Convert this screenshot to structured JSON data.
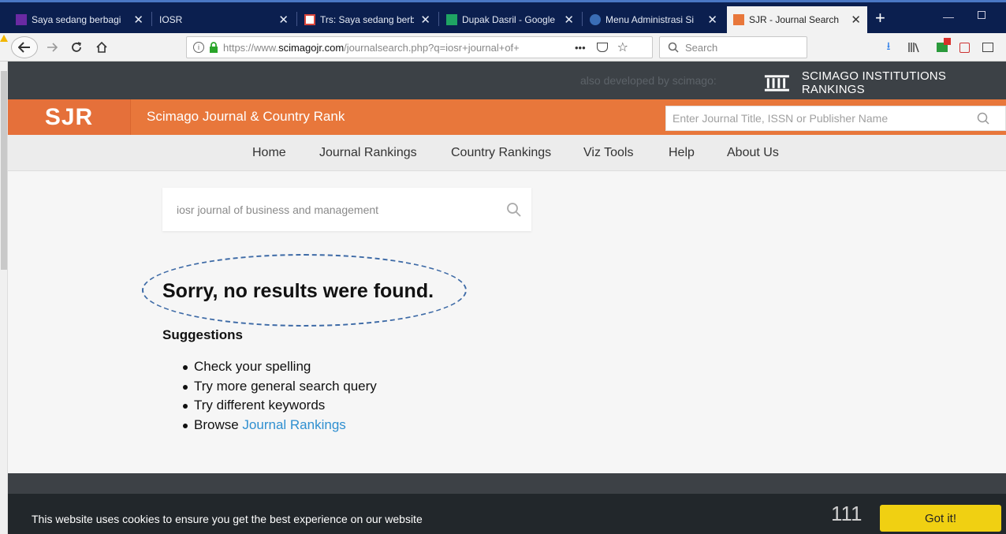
{
  "browser": {
    "tabs": [
      {
        "title": "Saya sedang berbagi",
        "icon": "yahoo-mail-icon",
        "color": "#6a2aa3"
      },
      {
        "title": "IOSR",
        "icon": "",
        "color": ""
      },
      {
        "title": "Trs: Saya sedang berb",
        "icon": "gmail-icon",
        "color": "#d9453b"
      },
      {
        "title": "Dupak Dasril - Google",
        "icon": "google-sheets-icon",
        "color": "#1fa463"
      },
      {
        "title": "Menu Administrasi Si",
        "icon": "site-icon",
        "color": "#3a6db5"
      },
      {
        "title": "SJR - Journal Search",
        "icon": "sjr-icon",
        "color": "#e8773b"
      }
    ],
    "url_prefix": "https://www.",
    "url_domain": "scimagojr.com",
    "url_rest": "/journalsearch.php?q=iosr+journal+of+",
    "search_placeholder": "Search",
    "more_label": "•••"
  },
  "page": {
    "dev_text": "also developed by scimago:",
    "sir_label": "SCIMAGO INSTITUTIONS RANKINGS",
    "logo": "SJR",
    "site_title": "Scimago Journal & Country Rank",
    "header_search_placeholder": "Enter Journal Title, ISSN or Publisher Name",
    "menu": [
      "Home",
      "Journal Rankings",
      "Country Rankings",
      "Viz Tools",
      "Help",
      "About Us"
    ],
    "search_value": "iosr journal of business and management",
    "no_results": "Sorry, no results were found.",
    "suggestions_title": "Suggestions",
    "suggestions": [
      "Check your spelling",
      "Try more general search query",
      "Try different keywords"
    ],
    "browse_prefix": "Browse",
    "browse_link": "Journal Rankings",
    "cookie_text": "This website uses cookies to ensure you get the best experience on our website",
    "page_number": "111",
    "got_it": "Got it!"
  },
  "colors": {
    "accent_orange": "#e8773b",
    "dark_strip": "#3c4146",
    "link_blue": "#2f8fd0",
    "button_yellow": "#f0d012"
  }
}
